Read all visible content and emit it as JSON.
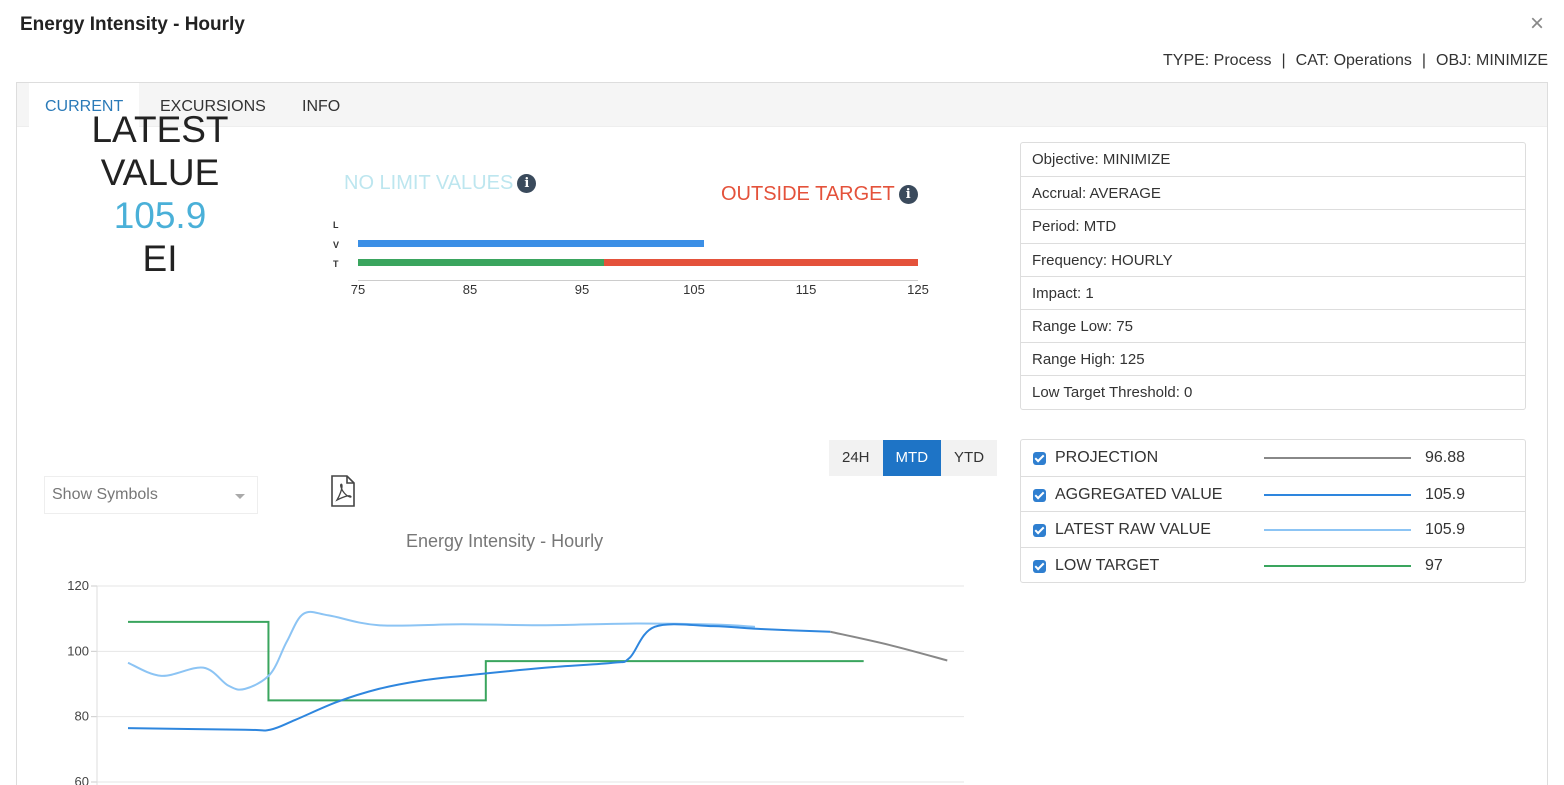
{
  "window": {
    "title": "Energy Intensity - Hourly",
    "close_glyph": "×"
  },
  "meta": {
    "type": "TYPE: Process",
    "cat": "CAT: Operations",
    "obj": "OBJ: MINIMIZE",
    "separator": "|"
  },
  "tabs": [
    {
      "label": "CURRENT",
      "active": true
    },
    {
      "label": "EXCURSIONS",
      "active": false
    },
    {
      "label": "INFO",
      "active": false
    }
  ],
  "latest": {
    "line1": "LATEST",
    "line2": "VALUE",
    "value": "105.9",
    "unit": "EI"
  },
  "gauge": {
    "status_left": "NO LIMIT VALUES",
    "status_right": "OUTSIDE TARGET",
    "row_labels": [
      "L",
      "V",
      "T"
    ],
    "ticks": [
      "75",
      "85",
      "95",
      "105",
      "115",
      "125"
    ],
    "range": [
      75,
      125
    ],
    "value": 105.9,
    "target": 97,
    "colors": {
      "value": "#3b8fe6",
      "target_ok": "#3aa55e",
      "target_out": "#e4523b"
    }
  },
  "properties": [
    "Objective: MINIMIZE",
    "Accrual: AVERAGE",
    "Period: MTD",
    "Frequency: HOURLY",
    "Impact: 1",
    "Range Low: 75",
    "Range High: 125",
    "Low Target Threshold: 0"
  ],
  "range_buttons": [
    {
      "label": "24H",
      "active": false
    },
    {
      "label": "MTD",
      "active": true
    },
    {
      "label": "YTD",
      "active": false
    }
  ],
  "symbols_dropdown": {
    "selected": "Show Symbols"
  },
  "icons": {
    "pdf": "pdf-icon",
    "info": "info-icon",
    "close": "close-icon"
  },
  "series_legend": [
    {
      "name": "PROJECTION",
      "value": "96.88",
      "color": "#888888"
    },
    {
      "name": "AGGREGATED VALUE",
      "value": "105.9",
      "color": "#2e86de"
    },
    {
      "name": "LATEST RAW VALUE",
      "value": "105.9",
      "color": "#8cc4f4"
    },
    {
      "name": "LOW TARGET",
      "value": "97",
      "color": "#3aa55e"
    }
  ],
  "chart_data": {
    "type": "line",
    "title": "Energy Intensity - Hourly",
    "ylim": [
      60,
      120
    ],
    "yticks": [
      "120",
      "100",
      "80",
      "60"
    ],
    "grid": true,
    "series": [
      {
        "name": "LOW TARGET",
        "color": "#3aa55e",
        "step": true,
        "points": [
          [
            0,
            109
          ],
          [
            0.168,
            109
          ],
          [
            0.168,
            85
          ],
          [
            0.428,
            85
          ],
          [
            0.428,
            97
          ],
          [
            0.88,
            97
          ]
        ]
      },
      {
        "name": "LATEST RAW VALUE",
        "color": "#8cc4f4",
        "points": [
          [
            0,
            96.5
          ],
          [
            0.04,
            92.5
          ],
          [
            0.09,
            95
          ],
          [
            0.12,
            89.5
          ],
          [
            0.14,
            88.5
          ],
          [
            0.17,
            93
          ],
          [
            0.19,
            103
          ],
          [
            0.21,
            111.5
          ],
          [
            0.24,
            111
          ],
          [
            0.3,
            108
          ],
          [
            0.4,
            108.3
          ],
          [
            0.5,
            108
          ],
          [
            0.6,
            108.5
          ],
          [
            0.7,
            108.2
          ],
          [
            0.75,
            107.5
          ]
        ]
      },
      {
        "name": "AGGREGATED VALUE",
        "color": "#2e86de",
        "points": [
          [
            0,
            76.5
          ],
          [
            0.14,
            76
          ],
          [
            0.17,
            76
          ],
          [
            0.2,
            79
          ],
          [
            0.25,
            84.5
          ],
          [
            0.3,
            88.5
          ],
          [
            0.35,
            91
          ],
          [
            0.4,
            92.5
          ],
          [
            0.5,
            95
          ],
          [
            0.58,
            96.5
          ],
          [
            0.6,
            98
          ],
          [
            0.63,
            107.5
          ],
          [
            0.7,
            107.7
          ],
          [
            0.76,
            106.8
          ],
          [
            0.84,
            106
          ]
        ]
      },
      {
        "name": "PROJECTION",
        "color": "#888888",
        "points": [
          [
            0.84,
            106
          ],
          [
            0.91,
            102
          ],
          [
            0.98,
            97.2
          ]
        ]
      }
    ]
  }
}
